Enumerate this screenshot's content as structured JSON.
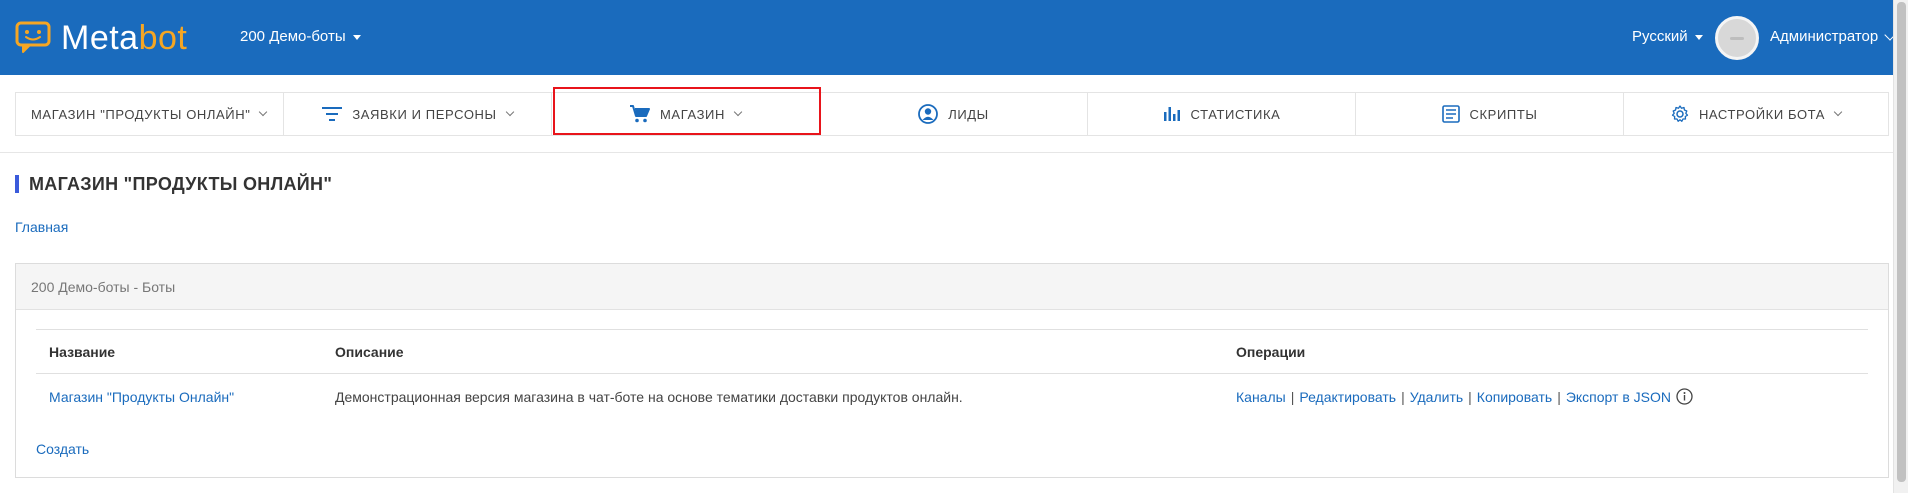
{
  "header": {
    "logo": {
      "part1": "Meta",
      "part2": "bot"
    },
    "workspace": "200 Демо-боты",
    "language": "Русский",
    "user": "Администратор",
    "brand_color": "#1a6bbd",
    "accent_color": "#f5a623"
  },
  "nav": {
    "items": [
      {
        "label": "МАГАЗИН \"ПРОДУКТЫ ОНЛАЙН\"",
        "icon": "none",
        "dropdown": true
      },
      {
        "label": "ЗАЯВКИ И ПЕРСОНЫ",
        "icon": "filter-icon",
        "dropdown": true
      },
      {
        "label": "МАГАЗИН",
        "icon": "cart-icon",
        "dropdown": true,
        "highlighted": true
      },
      {
        "label": "ЛИДЫ",
        "icon": "user-circle-icon",
        "dropdown": false
      },
      {
        "label": "СТАТИСТИКА",
        "icon": "bar-chart-icon",
        "dropdown": false
      },
      {
        "label": "СКРИПТЫ",
        "icon": "script-list-icon",
        "dropdown": false
      },
      {
        "label": "НАСТРОЙКИ БОТА",
        "icon": "gear-icon",
        "dropdown": true
      }
    ],
    "highlight_color": "#e8141b"
  },
  "page": {
    "title": "МАГАЗИН \"ПРОДУКТЫ ОНЛАЙН\"",
    "breadcrumb": "Главная"
  },
  "panel": {
    "heading": "200 Демо-боты - Боты",
    "columns": [
      "Название",
      "Описание",
      "Операции"
    ],
    "rows": [
      {
        "name": "Магазин \"Продукты Онлайн\"",
        "description": "Демонстрационная версия магазина в чат-боте на основе тематики доставки продуктов онлайн.",
        "operations": [
          "Каналы",
          "Редактировать",
          "Удалить",
          "Копировать",
          "Экспорт в JSON"
        ],
        "separator": "|"
      }
    ],
    "create_label": "Создать"
  }
}
